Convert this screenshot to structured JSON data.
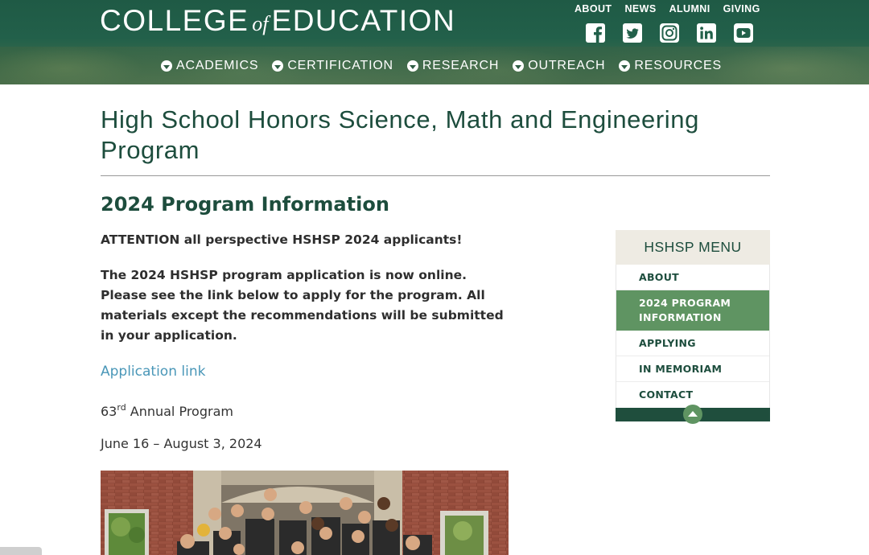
{
  "header": {
    "logo": {
      "part1": "COLLEGE",
      "of": "of",
      "part2": "EDUCATION"
    },
    "top_links": [
      "ABOUT",
      "NEWS",
      "ALUMNI",
      "GIVING"
    ],
    "social_icons": [
      "facebook-icon",
      "twitter-icon",
      "instagram-icon",
      "linkedin-icon",
      "youtube-icon"
    ],
    "nav": [
      "ACADEMICS",
      "CERTIFICATION",
      "RESEARCH",
      "OUTREACH",
      "RESOURCES"
    ]
  },
  "page": {
    "title": "High School Honors Science, Math and Engineering Program",
    "section_heading": "2024 Program Information",
    "attention": "ATTENTION all perspective HSHSP 2024 applicants!",
    "application_text": "The 2024 HSHSP program application is now online. Please see the link below to apply for the program. All materials except the recommendations will be submitted in your application.",
    "application_link": "Application link",
    "annual_number": "63",
    "annual_suffix": "rd",
    "annual_text": " Annual Program",
    "dates": "June 16 – August 3, 2024"
  },
  "sidebar": {
    "heading": "HSHSP MENU",
    "items": [
      {
        "label": "ABOUT"
      },
      {
        "label": "2024 PROGRAM INFORMATION",
        "active": true
      },
      {
        "label": "APPLYING"
      },
      {
        "label": "IN MEMORIAM"
      },
      {
        "label": "CONTACT"
      }
    ]
  },
  "colors": {
    "brand_green": "#1d4d3d",
    "accent_green": "#5f9462",
    "link_blue": "#4a97b8"
  }
}
